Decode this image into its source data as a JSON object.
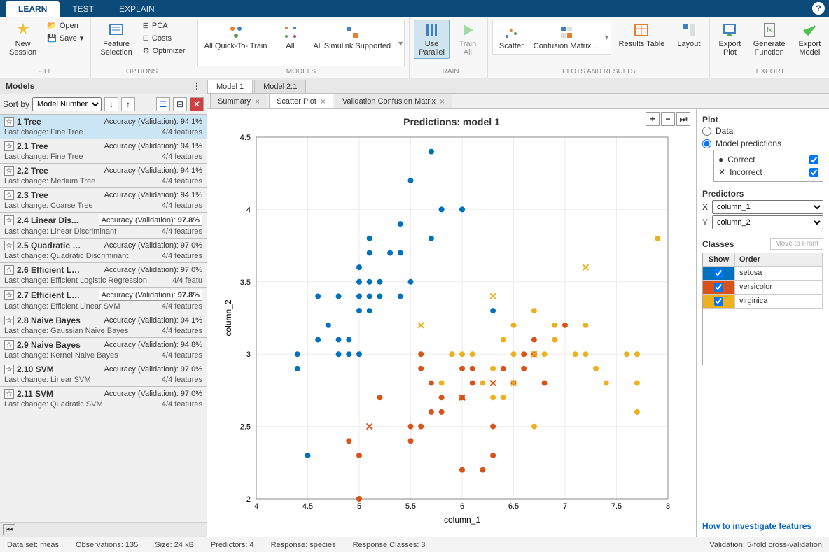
{
  "tabs": {
    "learn": "LEARN",
    "test": "TEST",
    "explain": "EXPLAIN"
  },
  "ribbon": {
    "file": {
      "label": "FILE",
      "new": "New\nSession",
      "open": "Open",
      "save": "Save"
    },
    "options": {
      "label": "OPTIONS",
      "feature": "Feature\nSelection",
      "pca": "PCA",
      "costs": "Costs",
      "optimizer": "Optimizer"
    },
    "models": {
      "label": "MODELS",
      "quick": "All Quick-To-\nTrain",
      "all": "All",
      "simulink": "All Simulink\nSupported"
    },
    "train": {
      "label": "TRAIN",
      "useParallel": "Use\nParallel",
      "trainAll": "Train\nAll"
    },
    "plots": {
      "label": "PLOTS AND RESULTS",
      "scatter": "Scatter",
      "confusion": "Confusion\nMatrix  ...",
      "resultsTable": "Results\nTable",
      "layout": "Layout"
    },
    "export": {
      "label": "EXPORT",
      "exportPlot": "Export\nPlot",
      "generate": "Generate\nFunction",
      "exportModel": "Export\nModel"
    }
  },
  "modelsPanel": {
    "title": "Models",
    "sortBy": "Sort by",
    "sortField": "Model Number",
    "items": [
      {
        "id": "1",
        "type": "Tree",
        "acc": "Accuracy (Validation): 94.1%",
        "change": "Fine Tree",
        "feat": "4/4 features",
        "selected": true
      },
      {
        "id": "2.1",
        "type": "Tree",
        "acc": "Accuracy (Validation): 94.1%",
        "change": "Fine Tree",
        "feat": "4/4 features"
      },
      {
        "id": "2.2",
        "type": "Tree",
        "acc": "Accuracy (Validation): 94.1%",
        "change": "Medium Tree",
        "feat": "4/4 features"
      },
      {
        "id": "2.3",
        "type": "Tree",
        "acc": "Accuracy (Validation): 94.1%",
        "change": "Coarse Tree",
        "feat": "4/4 features"
      },
      {
        "id": "2.4",
        "type": "Linear Dis...",
        "acc": "Accuracy (Validation): ",
        "accBold": "97.8%",
        "boxed": true,
        "change": "Linear Discriminant",
        "feat": "4/4 features"
      },
      {
        "id": "2.5",
        "type": "Quadratic …",
        "acc": "Accuracy (Validation): 97.0%",
        "change": "Quadratic Discriminant",
        "feat": "4/4 features"
      },
      {
        "id": "2.6",
        "type": "Efficient L…",
        "acc": "Accuracy (Validation): 97.0%",
        "change": "Efficient Logistic Regression",
        "feat": "4/4 featu"
      },
      {
        "id": "2.7",
        "type": "Efficient L…",
        "acc": "Accuracy (Validation): ",
        "accBold": "97.8%",
        "boxed": true,
        "change": "Efficient Linear SVM",
        "feat": "4/4 features"
      },
      {
        "id": "2.8",
        "type": "Naive Bayes",
        "acc": "Accuracy (Validation): 94.1%",
        "change": "Gaussian Naive Bayes",
        "feat": "4/4 features"
      },
      {
        "id": "2.9",
        "type": "Naive Bayes",
        "acc": "Accuracy (Validation): 94.8%",
        "change": "Kernel Naive Bayes",
        "feat": "4/4 features"
      },
      {
        "id": "2.10",
        "type": "SVM",
        "acc": "Accuracy (Validation): 97.0%",
        "change": "Linear SVM",
        "feat": "4/4 features"
      },
      {
        "id": "2.11",
        "type": "SVM",
        "acc": "Accuracy (Validation): 97.0%",
        "change": "Quadratic SVM",
        "feat": "4/4 features"
      }
    ],
    "lastChangePrefix": "Last change: "
  },
  "docTabs": {
    "model1": "Model 1",
    "model21": "Model 2.1"
  },
  "subTabs": {
    "summary": "Summary",
    "scatter": "Scatter Plot",
    "confusion": "Validation Confusion Matrix"
  },
  "chart": {
    "title": "Predictions: model 1",
    "xlabel": "column_1",
    "ylabel": "column_2"
  },
  "rightPanel": {
    "plot": "Plot",
    "data": "Data",
    "modelPred": "Model predictions",
    "correct": "Correct",
    "incorrect": "Incorrect",
    "predictors": "Predictors",
    "x": "X",
    "xval": "column_1",
    "y": "Y",
    "yval": "column_2",
    "classes": "Classes",
    "moveFront": "Move to Front",
    "show": "Show",
    "order": "Order",
    "classList": [
      {
        "name": "setosa",
        "color": "#0072bd"
      },
      {
        "name": "versicolor",
        "color": "#d95319"
      },
      {
        "name": "virginica",
        "color": "#edb120"
      }
    ],
    "howTo": "How to investigate features"
  },
  "status": {
    "dataset": "Data set: meas",
    "obs": "Observations: 135",
    "size": "Size: 24 kB",
    "pred": "Predictors: 4",
    "resp": "Response: species",
    "classes": "Response Classes: 3",
    "validation": "Validation: 5-fold cross-validation"
  },
  "chart_data": {
    "type": "scatter",
    "title": "Predictions: model 1",
    "xlabel": "column_1",
    "ylabel": "column_2",
    "xlim": [
      4,
      8
    ],
    "ylim": [
      2,
      4.5
    ],
    "xticks": [
      4,
      4.5,
      5,
      5.5,
      6,
      6.5,
      7,
      7.5,
      8
    ],
    "yticks": [
      2,
      2.5,
      3,
      3.5,
      4,
      4.5
    ],
    "series": [
      {
        "name": "setosa-correct",
        "marker": "circle",
        "color": "#0072bd",
        "x": [
          4.4,
          4.4,
          4.5,
          4.6,
          4.6,
          4.7,
          4.8,
          4.8,
          4.8,
          4.9,
          4.9,
          5.0,
          5.0,
          5.0,
          5.0,
          5.0,
          5.1,
          5.1,
          5.1,
          5.1,
          5.1,
          5.2,
          5.2,
          5.3,
          5.4,
          5.4,
          5.4,
          5.5,
          5.5,
          5.7,
          5.7,
          5.8,
          6.0,
          6.3
        ],
        "y": [
          2.9,
          3.0,
          2.3,
          3.1,
          3.4,
          3.2,
          3.0,
          3.1,
          3.4,
          3.0,
          3.1,
          3.0,
          3.3,
          3.4,
          3.5,
          3.6,
          3.4,
          3.5,
          3.7,
          3.8,
          3.3,
          3.4,
          3.5,
          3.7,
          3.4,
          3.7,
          3.9,
          3.5,
          4.2,
          3.8,
          4.4,
          4.0,
          4.0,
          3.3
        ]
      },
      {
        "name": "versicolor-correct",
        "marker": "circle",
        "color": "#d95319",
        "x": [
          4.9,
          5.0,
          5.0,
          5.2,
          5.5,
          5.5,
          5.6,
          5.6,
          5.6,
          5.7,
          5.7,
          5.8,
          5.8,
          5.9,
          6.0,
          6.0,
          6.0,
          6.1,
          6.1,
          6.2,
          6.3,
          6.3,
          6.4,
          6.5,
          6.6,
          6.6,
          6.7,
          6.7,
          6.8,
          6.9,
          7.0
        ],
        "y": [
          2.4,
          2.0,
          2.3,
          2.7,
          2.4,
          2.5,
          2.5,
          2.9,
          3.0,
          2.6,
          2.8,
          2.6,
          2.7,
          3.0,
          2.2,
          2.7,
          2.9,
          2.8,
          2.9,
          2.2,
          2.3,
          2.5,
          2.9,
          2.8,
          2.9,
          3.0,
          3.0,
          3.1,
          2.8,
          3.1,
          3.2
        ]
      },
      {
        "name": "versicolor-incorrect",
        "marker": "x",
        "color": "#d95319",
        "x": [
          5.1,
          6.0,
          6.3
        ],
        "y": [
          2.5,
          2.7,
          2.8
        ]
      },
      {
        "name": "virginica-correct",
        "marker": "circle",
        "color": "#edb120",
        "x": [
          5.8,
          5.9,
          6.0,
          6.1,
          6.2,
          6.3,
          6.3,
          6.4,
          6.4,
          6.5,
          6.5,
          6.7,
          6.7,
          6.8,
          6.9,
          6.9,
          7.1,
          7.2,
          7.2,
          7.3,
          7.4,
          7.6,
          7.7,
          7.7,
          7.7,
          7.9
        ],
        "y": [
          2.8,
          3.0,
          3.0,
          3.0,
          2.8,
          2.7,
          2.9,
          2.7,
          3.1,
          3.0,
          3.2,
          2.5,
          3.3,
          3.0,
          3.1,
          3.2,
          3.0,
          3.0,
          3.2,
          2.9,
          2.8,
          3.0,
          2.6,
          2.8,
          3.0,
          3.8
        ]
      },
      {
        "name": "virginica-incorrect",
        "marker": "x",
        "color": "#edb120",
        "x": [
          5.6,
          6.3,
          6.5,
          6.7,
          7.2
        ],
        "y": [
          3.2,
          3.4,
          2.8,
          3.0,
          3.6
        ]
      }
    ]
  }
}
